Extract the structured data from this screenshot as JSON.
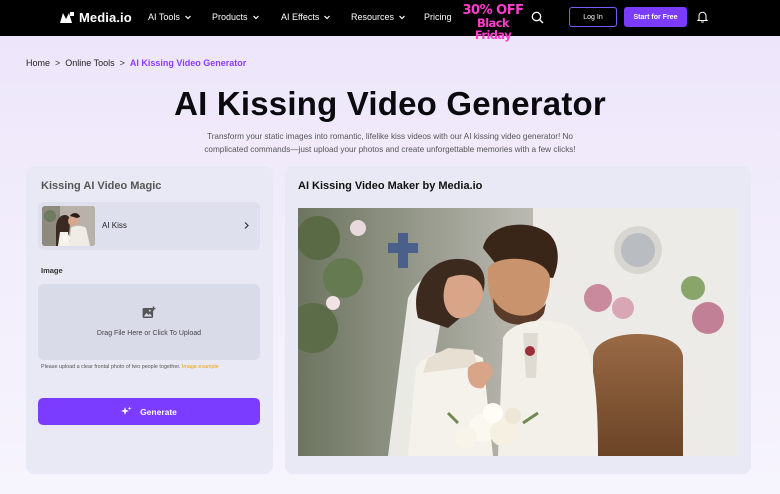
{
  "nav": {
    "logo_text": "Media.io",
    "items": [
      {
        "label": "AI Tools"
      },
      {
        "label": "Products"
      },
      {
        "label": "AI Effects"
      },
      {
        "label": "Resources"
      },
      {
        "label": "Pricing"
      }
    ],
    "promo_line1": "30% OFF",
    "promo_line2": "Black Friday",
    "login_label": "Log In",
    "start_label": "Start for Free",
    "icons": [
      "search-icon",
      "bell-icon",
      "chevron-down-icon"
    ]
  },
  "breadcrumb": {
    "items": [
      "Home",
      "Online Tools"
    ],
    "separator": ">",
    "current": "AI Kissing Video Generator"
  },
  "hero": {
    "title": "AI Kissing Video Generator",
    "subtitle": "Transform your static images into romantic, lifelike kiss videos with our AI kissing video generator! No complicated commands—just upload your photos and create unforgettable memories with a few clicks!"
  },
  "left_panel": {
    "heading": "Kissing AI Video Magic",
    "tool_label": "AI Kiss",
    "image_label": "Image",
    "upload_text": "Drag File Here or Click To Upload",
    "hint_text": "Please upload a clear frontal photo of two people together.",
    "hint_link": "Image example",
    "generate_label": "Generate"
  },
  "right_panel": {
    "heading": "AI Kissing Video Maker by Media.io"
  },
  "colors": {
    "accent": "#7b3cff",
    "promo": "#ff3ecf",
    "breadcrumb_current": "#8b3cff",
    "hint_link": "#f2a100",
    "nav_bg": "#000000"
  }
}
